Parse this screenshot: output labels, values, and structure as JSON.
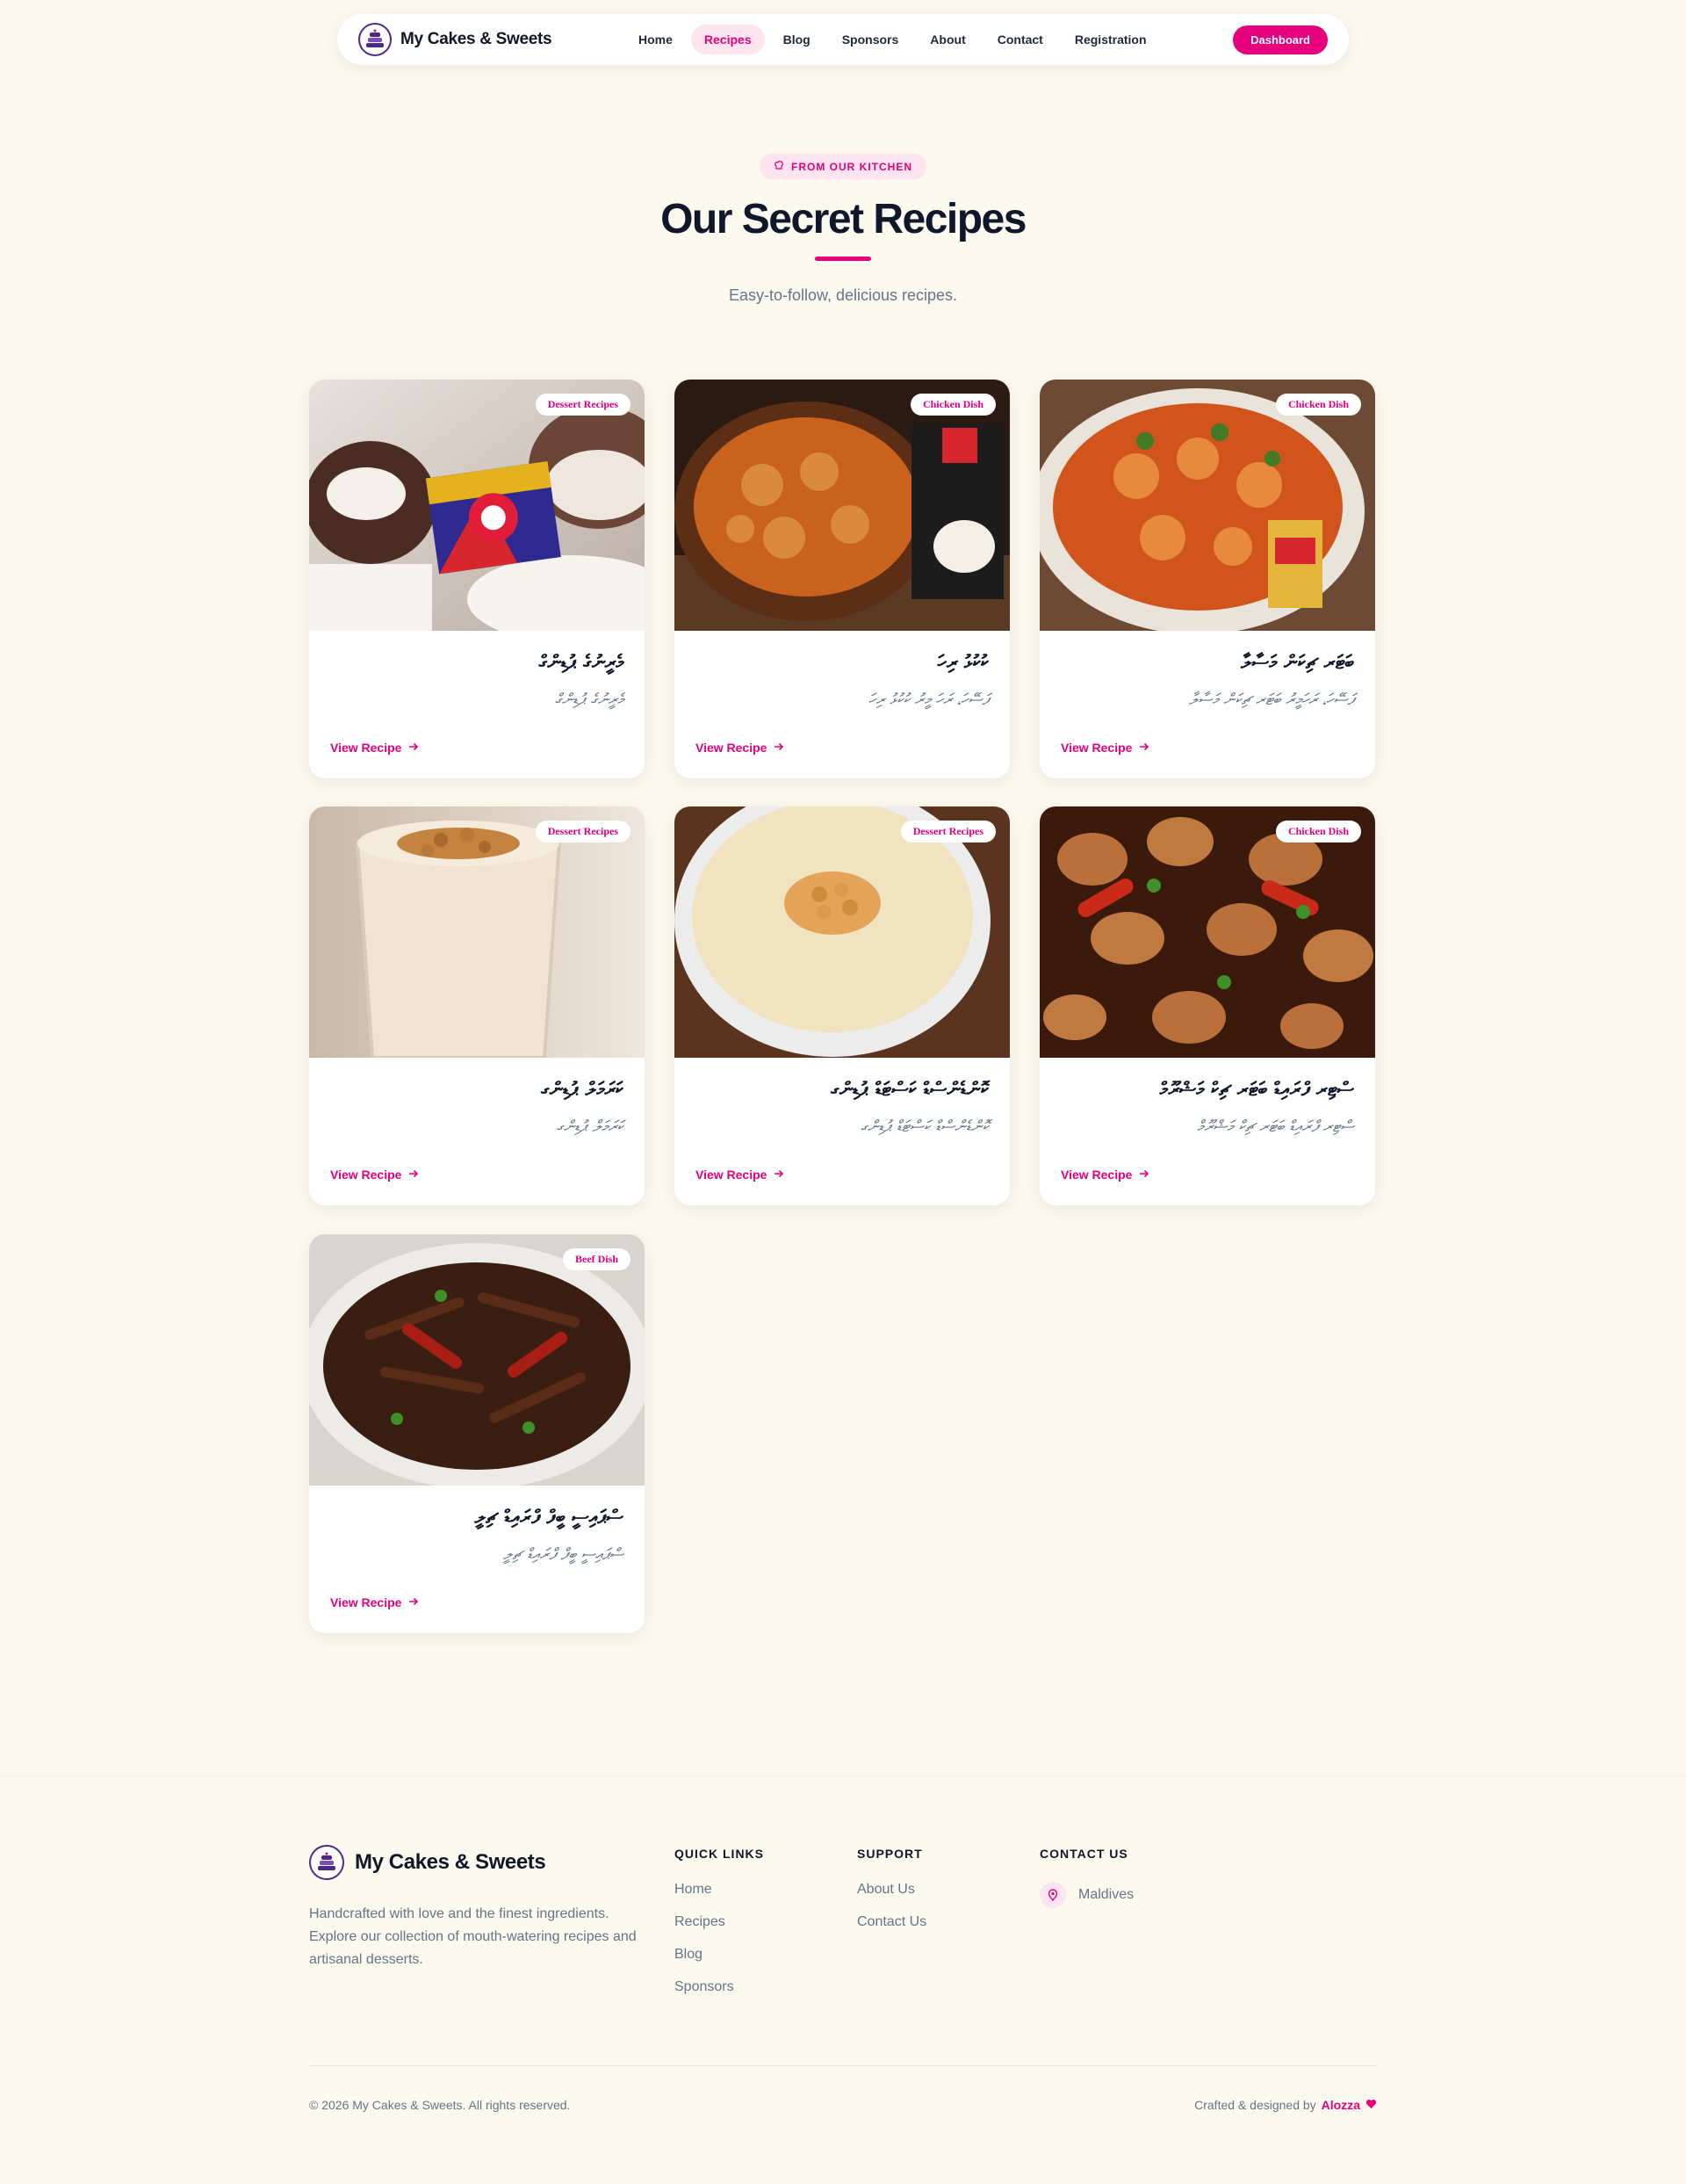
{
  "nav": {
    "brand": "My Cakes & Sweets",
    "links": [
      "Home",
      "Recipes",
      "Blog",
      "Sponsors",
      "About",
      "Contact",
      "Registration"
    ],
    "active": "Recipes",
    "dashboard_label": "Dashboard"
  },
  "hero": {
    "eyebrow": "FROM OUR KITCHEN",
    "title": "Our Secret Recipes",
    "subtitle": "Easy-to-follow, delicious recipes."
  },
  "recipes": [
    {
      "badge": "Dessert Recipes",
      "title": "މެރީނުގެ ޕުޑިންގް",
      "desc": "މެރީނުގެ ޕުޑިންގް",
      "link": "View Recipe"
    },
    {
      "badge": "Chicken Dish",
      "title": "ކުކުޅު ރިހަ",
      "desc": "ފަސޭހަ، ރަހަ މީރު ކުކުޅު ރިހަ",
      "link": "View Recipe"
    },
    {
      "badge": "Chicken Dish",
      "title": "ބަޓަރ ޗިކަން މަސާލާ",
      "desc": "ފަސޭހަ، ރަހަމީރު ބަޓަރ ޗިކަން މަސާލާ",
      "link": "View Recipe"
    },
    {
      "badge": "Dessert Recipes",
      "title": "ކަރަމަލް ޕުޑިންގ",
      "desc": "ކަރަމަލް ޕުޑިންގ",
      "link": "View Recipe"
    },
    {
      "badge": "Dessert Recipes",
      "title": "ކޮންޑެންސްޑް ކަސްޓަޑް ޕުޑިންގ",
      "desc": "ކޮންޑެންސްޑް ކަސްޓަޑް ޕުޑިންގ",
      "link": "View Recipe"
    },
    {
      "badge": "Chicken Dish",
      "title": "ސްޓިރ ފްރައިޑް ބަޓަރ ޗިކް މަޝްރޫމް",
      "desc": "ސްޓިރ ފްރައިޑް ބަޓަރ ޗިކް މަޝްރޫމް",
      "link": "View Recipe"
    },
    {
      "badge": "Beef Dish",
      "title": "ސްޕައިސީ ބީފް ފްރައިޑް ޗިލީ",
      "desc": "ސްޕައިސީ ބީފް ފްރައިޑް ޗިލީ",
      "link": "View Recipe"
    }
  ],
  "footer": {
    "brand": "My Cakes & Sweets",
    "about": "Handcrafted with love and the finest ingredients. Explore our collection of mouth-watering recipes and artisanal desserts.",
    "quick_links": {
      "title": "QUICK LINKS",
      "items": [
        "Home",
        "Recipes",
        "Blog",
        "Sponsors"
      ]
    },
    "support": {
      "title": "SUPPORT",
      "items": [
        "About Us",
        "Contact Us"
      ]
    },
    "contact": {
      "title": "CONTACT US",
      "location": "Maldives"
    },
    "copyright": "© 2026 My Cakes & Sweets. All rights reserved.",
    "crafted_prefix": "Crafted & designed by",
    "crafted_name": "Alozza"
  },
  "colors": {
    "accent": "#e6007e",
    "background": "#fcf9ee",
    "text": "#0f172a",
    "muted": "#64748b"
  }
}
